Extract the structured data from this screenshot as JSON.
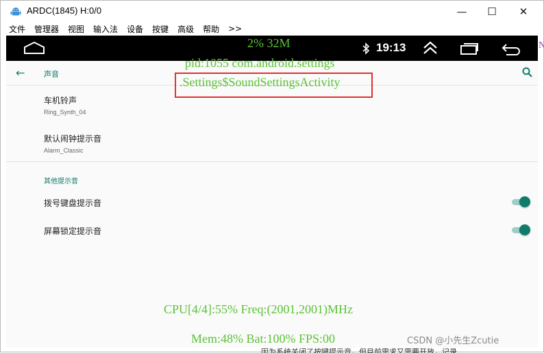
{
  "window": {
    "title": "ARDC(1845) H:0/0",
    "controls": {
      "minimize": "—",
      "maximize": "☐",
      "close": "✕"
    }
  },
  "menubar": {
    "items": [
      "文件",
      "管理器",
      "视图",
      "输入法",
      "设备",
      "按键",
      "高级",
      "帮助",
      ">>"
    ]
  },
  "statusbar": {
    "clock": "19:13"
  },
  "overlay": {
    "mem_cpu": "2% 32M",
    "pid_line": "pid:1055  com.android.settings",
    "activity": ".Settings$SoundSettingsActivity",
    "cpu_line": "CPU[4/4]:55% Freq:(2001,2001)MHz",
    "status_line": "Mem:48% Bat:100% FPS:00",
    "edge_char": "N",
    "colors": {
      "overlay_text": "#5bc236",
      "highlight_box": "#e03030"
    }
  },
  "toolbar": {
    "title": "声音"
  },
  "preferences": [
    {
      "title": "车机铃声",
      "summary": "Ring_Synth_04"
    },
    {
      "title": "默认闹钟提示音",
      "summary": "Alarm_Classic"
    }
  ],
  "category": {
    "title": "其他提示音",
    "switches": [
      {
        "label": "拨号键盘提示音",
        "checked": true
      },
      {
        "label": "屏幕锁定提示音",
        "checked": true
      }
    ]
  },
  "external": {
    "watermark": "CSDN @小先生Zcutie",
    "bottom_text": "因为系统关闭了按键提示音，但目前需求又需要开放，记录"
  },
  "colors": {
    "accent": "#0f7b6c",
    "statusbar": "#000000"
  }
}
